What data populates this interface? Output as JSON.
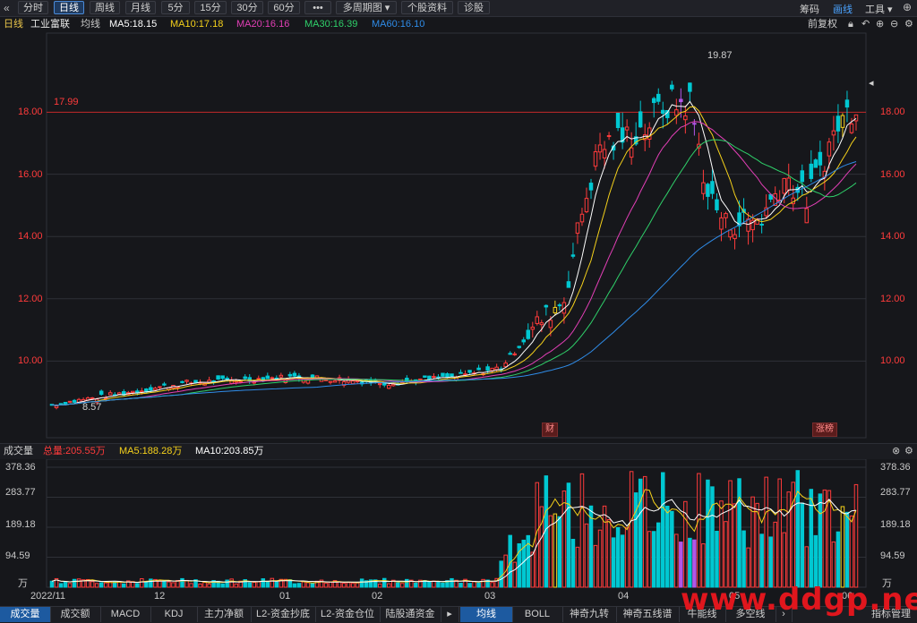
{
  "toolbar": {
    "back_icon": "double-chevron-left-icon",
    "buttons": [
      "分时",
      "日线",
      "周线",
      "月线",
      "5分",
      "15分",
      "30分",
      "60分",
      "•••",
      "多周期图 ▾",
      "个股资料",
      "诊股"
    ],
    "active_index": 1,
    "right": [
      "筹码",
      "画线",
      "工具 ▾"
    ],
    "right_active_index": 1
  },
  "legend": {
    "period": "日线",
    "stock": "工业富联",
    "type": "均线",
    "ma5": "MA5:18.15",
    "ma10": "MA10:17.18",
    "ma20": "MA20:16.16",
    "ma30": "MA30:16.39",
    "ma60": "MA60:16.10",
    "adjust": "前复权"
  },
  "price_axis": {
    "ticks": [
      "18.00",
      "16.00",
      "14.00",
      "12.00",
      "10.00"
    ],
    "reference_value": "17.99",
    "high_label": "19.87",
    "low_label": "8.57"
  },
  "tags": {
    "cai": "财",
    "zhangting": "涨榜"
  },
  "volume": {
    "title": "成交量",
    "total": "总量:205.55万",
    "ma5": "MA5:188.28万",
    "ma10": "MA10:203.85万",
    "ticks": [
      "378.36",
      "283.77",
      "189.18",
      "94.59"
    ],
    "unit": "万"
  },
  "date_axis": [
    "2022/11",
    "12",
    "01",
    "02",
    "03",
    "04",
    "05",
    "06"
  ],
  "bottom_tabs": [
    "成交量",
    "成交额",
    "MACD",
    "KDJ",
    "主力净额",
    "L2-资金抄底",
    "L2-资金仓位",
    "陆股通资金",
    "均线",
    "BOLL",
    "神奇九转",
    "神奇五线谱",
    "牛能线",
    "多空线"
  ],
  "bottom_active": [
    0,
    8
  ],
  "bottom_right": "指标管理",
  "watermark": "www.ddgp.net",
  "colors": {
    "up": "#ff3b3b",
    "down": "#00c8d2",
    "ma5": "#ffffff",
    "ma10": "#f5d11b",
    "ma20": "#e23fb6",
    "ma30": "#2fd06a",
    "ma60": "#2f8ce8",
    "highlight": "#b256e8",
    "limit": "#f5d11b"
  }
}
